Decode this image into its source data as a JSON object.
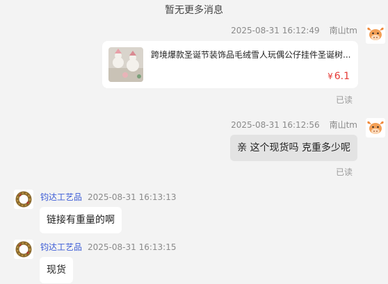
{
  "notice": "暂无更多消息",
  "messages": {
    "m1": {
      "time": "2025-08-31 16:12:49",
      "sender": "南山tm",
      "product_title": "跨境爆款圣诞节装饰品毛绒雪人玩偶公仔挂件圣诞树...",
      "price_currency": "¥",
      "price_value": "6.1",
      "read": "已读"
    },
    "m2": {
      "time": "2025-08-31 16:12:56",
      "sender": "南山tm",
      "text": "亲 这个现货吗 克重多少呢",
      "read": "已读"
    },
    "m3": {
      "sender": "钧达工艺品",
      "time": "2025-08-31 16:13:13",
      "text": "链接有重量的啊"
    },
    "m4": {
      "sender": "钧达工艺品",
      "time": "2025-08-31 16:13:15",
      "text": "现货"
    }
  },
  "icons": {
    "buyer_avatar": "cartoon-cow-avatar-icon",
    "seller_avatar": "wreath-avatar-icon"
  },
  "colors": {
    "price": "#e53935",
    "shop_name": "#3b5bd6",
    "outgoing_bubble": "#e3e3e3",
    "incoming_bubble": "#ffffff"
  }
}
